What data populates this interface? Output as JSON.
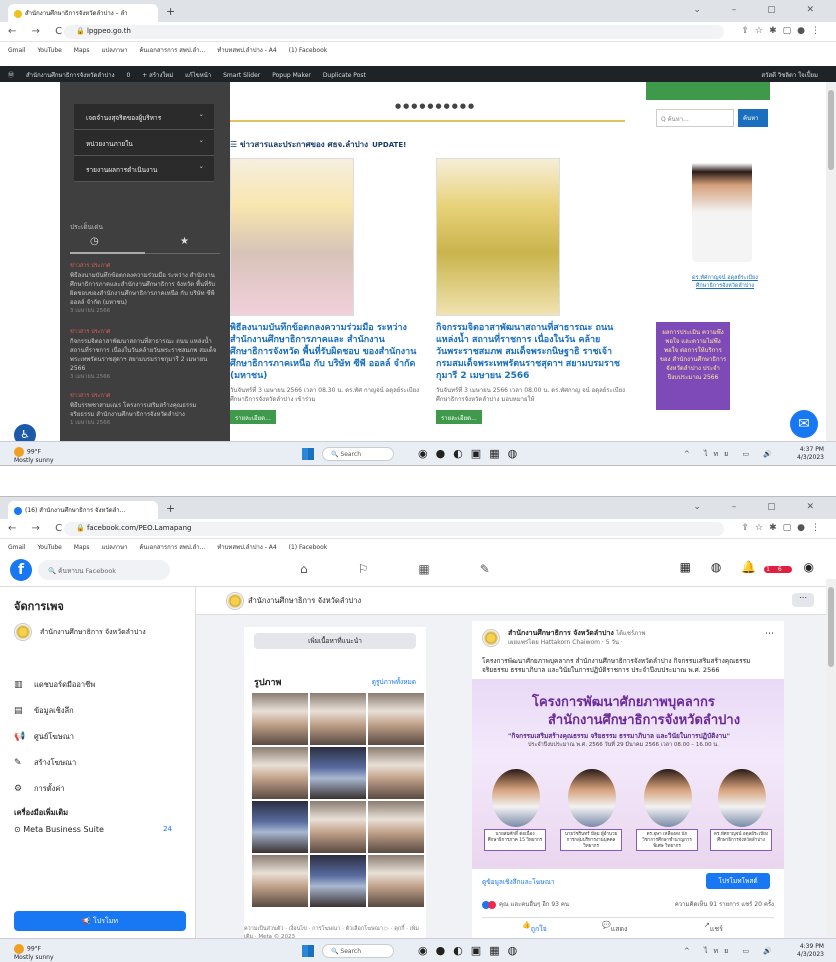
{
  "shot1": {
    "tab_title": "สำนักงานศึกษาธิการจังหวัดลำปาง – ลำ",
    "url": "lpgpeo.go.th",
    "bookmarks": [
      "Gmail",
      "YouTube",
      "Maps",
      "แปลภาษา",
      "ค้นเอกสารการ สพป.ลำ...",
      "ทำบทสพป.ลำปาง - A4",
      "(1) Facebook"
    ],
    "wpbar": {
      "items": [
        "สำนักงานศึกษาธิการจังหวัดลำปาง",
        "0",
        "+ สร้างใหม่",
        "แก้ไขหน้า",
        "Smart Slider",
        "Popup Maker",
        "Duplicate Post"
      ],
      "right": "สวัสดี วิชลิดา ใจเปี้ยม"
    },
    "left_menu": [
      "เจตจำนงสุจริตของผู้บริหาร",
      "หน่วยงานภายใน",
      "รายงานผลการดำเนินงาน"
    ],
    "left_tabs_head": "ประเด็นเด่น",
    "news": [
      {
        "cat": "ข่าวสาร ประกาศ",
        "text": "พิธีลงนามบันทึกข้อตกลงความร่วมมือ ระหว่าง สำนักงานศึกษาธิการภาคและสำนักงานศึกษาธิการ จังหวัด พื้นที่รับผิดชอบของสำนักงานศึกษาธิการภาคเหนือ กับ บริษัท ซีพี ออลล์ จำกัด (มหาชน)",
        "date": "3 เมษายน 2566"
      },
      {
        "cat": "ข่าวสาร ประกาศ",
        "text": "กิจกรรมจิตอาสาพัฒนาสถานที่สาธารณะ ถนน แหล่งน้ำ สถานที่ราชการ เนื่องในวันคล้ายวันพระราชสมภพ สมเด็จพระเทพรัตนราชสุดาฯ สยามบรมราชกุมารี 2 เมษายน 2566",
        "date": "3 เมษายน 2566"
      },
      {
        "cat": "ข่าวสาร ประกาศ",
        "text": "พิธีบรรพชาสามเณร โครงการเสริมสร้างคุณธรรม จริยธรรม สำนักงานศึกษาธิการจังหวัดลำปาง",
        "date": "1 เมษายน 2566"
      }
    ],
    "dots": "●●●●●●●●●●",
    "section_title": "ข่าวสารและประกาศของ ศธจ.ลำปาง",
    "update_label": "UPDATE!",
    "posts": [
      {
        "title": "พิธีลงนามบันทึกข้อตกลงความร่วมมือ ระหว่างสำนักงานศึกษาธิการภาคและ สำนักงานศึกษาธิการจังหวัด พื้นที่รับผิดชอบ ของสำนักงานศึกษาธิการภาคเหนือ กับ บริษัท ซีพี ออลล์ จำกัด (มหาชน)",
        "meta": "วันจันทร์ที่ 3 เมษายน 2566 เวลา 08.30 น. ดร.ทัศ กาญจน์ อดุลย์ระเบียง ศึกษาธิการจังหวัดลำปาง เข้าร่วม",
        "btn": "รายละเอียด..."
      },
      {
        "title": "กิจกรรมจิตอาสาพัฒนาสถานที่สาธารณะ ถนน แหล่งน้ำ สถานที่ราชการ เนื่องในวัน คล้ายวันพระราชสมภพ สมเด็จพระกนิษฐาธิ ราชเจ้า กรมสมเด็จพระเทพรัตนราชสุดาฯ สยามบรมราชกุมารี 2 เมษายน 2566",
        "meta": "วันจันทร์ที่ 3 เมษายน 2566 เวลา 08.00 น. ดร.ทัศกาญ จน์ อดุลย์ระเบียง ศึกษาธิการจังหวัดลำปาง มอบหมายให้",
        "btn": "รายละเอียด..."
      }
    ],
    "search_placeholder": "Q ค้นหา...",
    "search_btn": "ค้นหา",
    "portrait_caption": "ดร.ทัศกาญจน์ อดุลย์ระเบียง ศึกษาธิการจังหวัดลำปาง",
    "banner_text": "ผลการประเมิน ความพึงพอใจ และความไม่พึงพอใจ ต่อการให้บริการของ สำนักงานศึกษาธิการ จังหวัดลำปาง ประจำปีงบประมาณ 2566"
  },
  "shot2": {
    "tab_title": "(16) สำนักงานศึกษาธิการ จังหวัดลำ...",
    "url": "facebook.com/PEO.Lamapang",
    "bookmarks": [
      "Gmail",
      "YouTube",
      "Maps",
      "แปลภาษา",
      "ค้นเอกสารการ สพป.ลำ...",
      "ทำบทสพป.ลำปาง - A4",
      "(1) Facebook"
    ],
    "fb_search_placeholder": "ค้นหาบน Facebook",
    "notif_count": "16",
    "manage_title": "จัดการเพจ",
    "page_name": "สำนักงานศึกษาธิการ จังหวัดลำปาง",
    "menu": [
      "แดชบอร์ดมืออาชีพ",
      "ข้อมูลเชิงลึก",
      "ศูนย์โฆษณา",
      "สร้างโฆษณา",
      "การตั้งค่า"
    ],
    "more_tools": "เครื่องมือเพิ่มเติม",
    "mbs_label": "Meta Business Suite",
    "mbs_count": "24",
    "promote_btn": "โปรโมท",
    "page_header_name": "สำนักงานศึกษาธิการ จังหวัดลำปาง",
    "suggest_btn": "เพิ่มเนื้อหาที่แนะนำ",
    "photos_title": "รูปภาพ",
    "see_all": "ดูรูปภาพทั้งหมด",
    "footer": "ความเป็นส่วนตัว · เงื่อนไข · การโฆษณา · ตัวเลือกโฆษณา ▷ · คุกกี้ · เพิ่มเติม · Meta © 2023",
    "post": {
      "author": "สำนักงานศึกษาธิการ จังหวัดลำปาง",
      "with": "ได้แชร์ภาพ",
      "sub": "เผยแพร่โดย Hattakorn Chaiwom · 5 วัน ·",
      "text": "โครงการพัฒนาศักยภาพบุคลากร สำนักงานศึกษาธิการจังหวัดลำปาง กิจกรรมเสริมสร้างคุณธรรม จริยธรรม ธรรมาภิบาล และวินัยในการปฏิบัติราชการ ประจำปีงบประมาณ พ.ศ. 2566",
      "flyer_l1": "โครงการพัฒนาศักยภาพบุคลากร",
      "flyer_l2": "สำนักงานศึกษาธิการจังหวัดลำปาง",
      "flyer_l3": "\"กิจกรรมเสริมสร้างคุณธรรม จริยธรรม ธรรมาภิบาล และวินัยในการปฏิบัติงาน\"",
      "flyer_l4": "ประจำปีงบประมาณ พ.ศ. 2566 วันที่ 29 มีนาคม 2566 เวลา 08.00 – 16.00 น.",
      "speakers": [
        "นายสมศักดิ์ ต่อเนื่อง ศึกษาธิการภาค 15 วิทยากร",
        "นายวัชรินทร์ มีลุม ผู้อำนวยการกลุ่มบริหารงานบุคคล วิทยากร",
        "ดร.อุษา เหลืองสง นักวิชาการศึกษาชำนาญการพิเศษ วิทยากร",
        "ดร.ทัศกาญจน์ อดุลย์ระเบียง ศึกษาธิการจังหวัดลำปาง"
      ],
      "see_more": "ดูข้อมูลเชิงลึกและโฆษณา",
      "boost": "โปรโมทโพสต์",
      "reactions": "คุณ และคนอื่นๆ อีก 93 คน",
      "comments_shares": "ความคิดเห็น 91 รายการ  แชร์ 20 ครั้ง",
      "like": "ถูกใจ",
      "comment": "แสดงความคิดเห็น",
      "share": "แชร์"
    }
  },
  "taskbar": {
    "temp": "99°F",
    "weather": "Mostly sunny",
    "search": "Search",
    "time1": "4:37 PM",
    "date1": "4/3/2023",
    "time2": "4:39 PM",
    "date2": "4/3/2023",
    "lang": "ไทย"
  }
}
